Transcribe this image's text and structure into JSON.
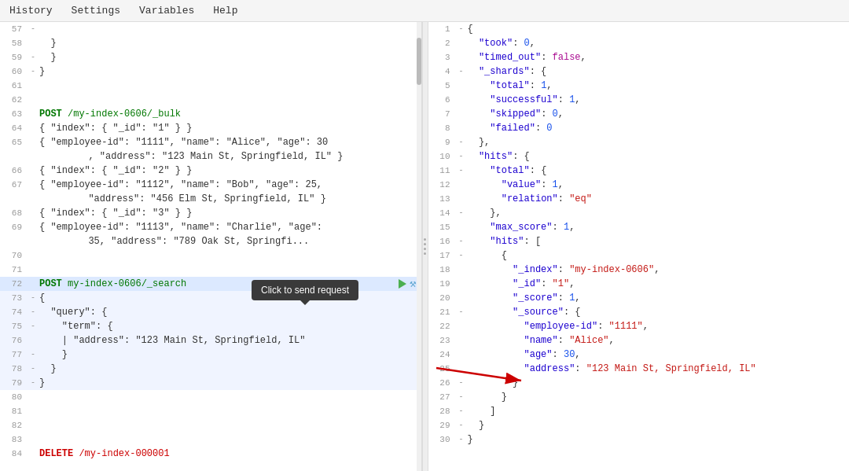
{
  "menu": {
    "items": [
      "History",
      "Settings",
      "Variables",
      "Help"
    ]
  },
  "left_panel": {
    "lines": [
      {
        "num": 57,
        "indent": "",
        "indicator": "-",
        "content": ""
      },
      {
        "num": 58,
        "indent": "  ",
        "indicator": "",
        "content": "  }"
      },
      {
        "num": 59,
        "indent": "",
        "indicator": "-",
        "content": "  }"
      },
      {
        "num": 60,
        "indent": "",
        "indicator": "-",
        "content": "}"
      },
      {
        "num": 61,
        "indent": "",
        "indicator": "",
        "content": ""
      },
      {
        "num": 62,
        "indent": "",
        "indicator": "",
        "content": ""
      },
      {
        "num": 63,
        "indent": "",
        "indicator": "",
        "content": "POST /my-index-0606/_bulk",
        "type": "post"
      },
      {
        "num": 64,
        "indent": "",
        "indicator": "",
        "content": "{ \"index\": { \"_id\": \"1\" } }"
      },
      {
        "num": 65,
        "indent": "",
        "indicator": "",
        "content": "{ \"employee-id\": \"1111\", \"name\": \"Alice\", \"age\": 30",
        "cont": ", \"address\": \"123 Main St, Springfield, IL\" }"
      },
      {
        "num": 66,
        "indent": "",
        "indicator": "",
        "content": "{ \"index\": { \"_id\": \"2\" } }"
      },
      {
        "num": 67,
        "indent": "",
        "indicator": "",
        "content": "{ \"employee-id\": \"1112\", \"name\": \"Bob\", \"age\": 25,",
        "cont": "  \"address\": \"456 Elm St, Springfield, IL\" }"
      },
      {
        "num": 68,
        "indent": "",
        "indicator": "",
        "content": "{ \"index\": { \"_id\": \"3\" } }"
      },
      {
        "num": 69,
        "indent": "",
        "indicator": "",
        "content": "{ \"employee-id\": \"1113\", \"name\": \"Charlie\", \"age\":",
        "cont": "  35, \"address\": \"789 Oak St, Springfi..."
      },
      {
        "num": 70,
        "indent": "",
        "indicator": "",
        "content": ""
      },
      {
        "num": 71,
        "indent": "",
        "indicator": "",
        "content": ""
      },
      {
        "num": 72,
        "indent": "",
        "indicator": "",
        "content": "POST my-index-0606/_search",
        "type": "post",
        "highlight": true
      },
      {
        "num": 73,
        "indent": "",
        "indicator": "-",
        "content": "{"
      },
      {
        "num": 74,
        "indent": "  ",
        "indicator": "-",
        "content": "  \"query\": {"
      },
      {
        "num": 75,
        "indent": "    ",
        "indicator": "-",
        "content": "    \"term\": {"
      },
      {
        "num": 76,
        "indent": "      ",
        "indicator": "",
        "content": "      \"address\": \"123 Main St, Springfield, IL\""
      },
      {
        "num": 77,
        "indent": "    ",
        "indicator": "-",
        "content": "    }"
      },
      {
        "num": 78,
        "indent": "  ",
        "indicator": "-",
        "content": "  }"
      },
      {
        "num": 79,
        "indent": "",
        "indicator": "-",
        "content": "}"
      },
      {
        "num": 80,
        "indent": "",
        "indicator": "",
        "content": ""
      },
      {
        "num": 81,
        "indent": "",
        "indicator": "",
        "content": ""
      },
      {
        "num": 82,
        "indent": "",
        "indicator": "",
        "content": ""
      },
      {
        "num": 83,
        "indent": "",
        "indicator": "",
        "content": ""
      },
      {
        "num": 84,
        "indent": "",
        "indicator": "",
        "content": "DELETE /my-index-000001",
        "type": "delete"
      }
    ]
  },
  "right_panel": {
    "lines": [
      {
        "num": 1,
        "indicator": "-",
        "content": "{"
      },
      {
        "num": 2,
        "indicator": "",
        "content": "  \"took\": 0,"
      },
      {
        "num": 3,
        "indicator": "",
        "content": "  \"timed_out\": false,"
      },
      {
        "num": 4,
        "indicator": "-",
        "content": "  \"_shards\": {"
      },
      {
        "num": 5,
        "indicator": "",
        "content": "    \"total\": 1,"
      },
      {
        "num": 6,
        "indicator": "",
        "content": "    \"successful\": 1,"
      },
      {
        "num": 7,
        "indicator": "",
        "content": "    \"skipped\": 0,"
      },
      {
        "num": 8,
        "indicator": "",
        "content": "    \"failed\": 0"
      },
      {
        "num": 9,
        "indicator": "-",
        "content": "  },"
      },
      {
        "num": 10,
        "indicator": "-",
        "content": "  \"hits\": {"
      },
      {
        "num": 11,
        "indicator": "-",
        "content": "    \"total\": {"
      },
      {
        "num": 12,
        "indicator": "",
        "content": "      \"value\": 1,"
      },
      {
        "num": 13,
        "indicator": "",
        "content": "      \"relation\": \"eq\""
      },
      {
        "num": 14,
        "indicator": "-",
        "content": "    },"
      },
      {
        "num": 15,
        "indicator": "",
        "content": "    \"max_score\": 1,"
      },
      {
        "num": 16,
        "indicator": "-",
        "content": "    \"hits\": ["
      },
      {
        "num": 17,
        "indicator": "-",
        "content": "      {"
      },
      {
        "num": 18,
        "indicator": "",
        "content": "        \"_index\": \"my-index-0606\","
      },
      {
        "num": 19,
        "indicator": "",
        "content": "        \"_id\": \"1\","
      },
      {
        "num": 20,
        "indicator": "",
        "content": "        \"_score\": 1,"
      },
      {
        "num": 21,
        "indicator": "-",
        "content": "        \"_source\": {"
      },
      {
        "num": 22,
        "indicator": "",
        "content": "          \"employee-id\": \"1111\","
      },
      {
        "num": 23,
        "indicator": "",
        "content": "          \"name\": \"Alice\","
      },
      {
        "num": 24,
        "indicator": "",
        "content": "          \"age\": 30,"
      },
      {
        "num": 25,
        "indicator": "",
        "content": "          \"address\": \"123 Main St, Springfield, IL\""
      },
      {
        "num": 26,
        "indicator": "-",
        "content": "        }"
      },
      {
        "num": 27,
        "indicator": "-",
        "content": "      }"
      },
      {
        "num": 28,
        "indicator": "-",
        "content": "    ]"
      },
      {
        "num": 29,
        "indicator": "-",
        "content": "  }"
      },
      {
        "num": 30,
        "indicator": "-",
        "content": "}"
      }
    ]
  },
  "tooltip": {
    "text": "Click to send request"
  },
  "colors": {
    "post": "#007700",
    "delete": "#cc0000",
    "highlight_bg": "#dce9ff",
    "key": "#1c00cf",
    "string": "#c41a16",
    "number": "#1750eb",
    "bool": "#aa0d91"
  }
}
